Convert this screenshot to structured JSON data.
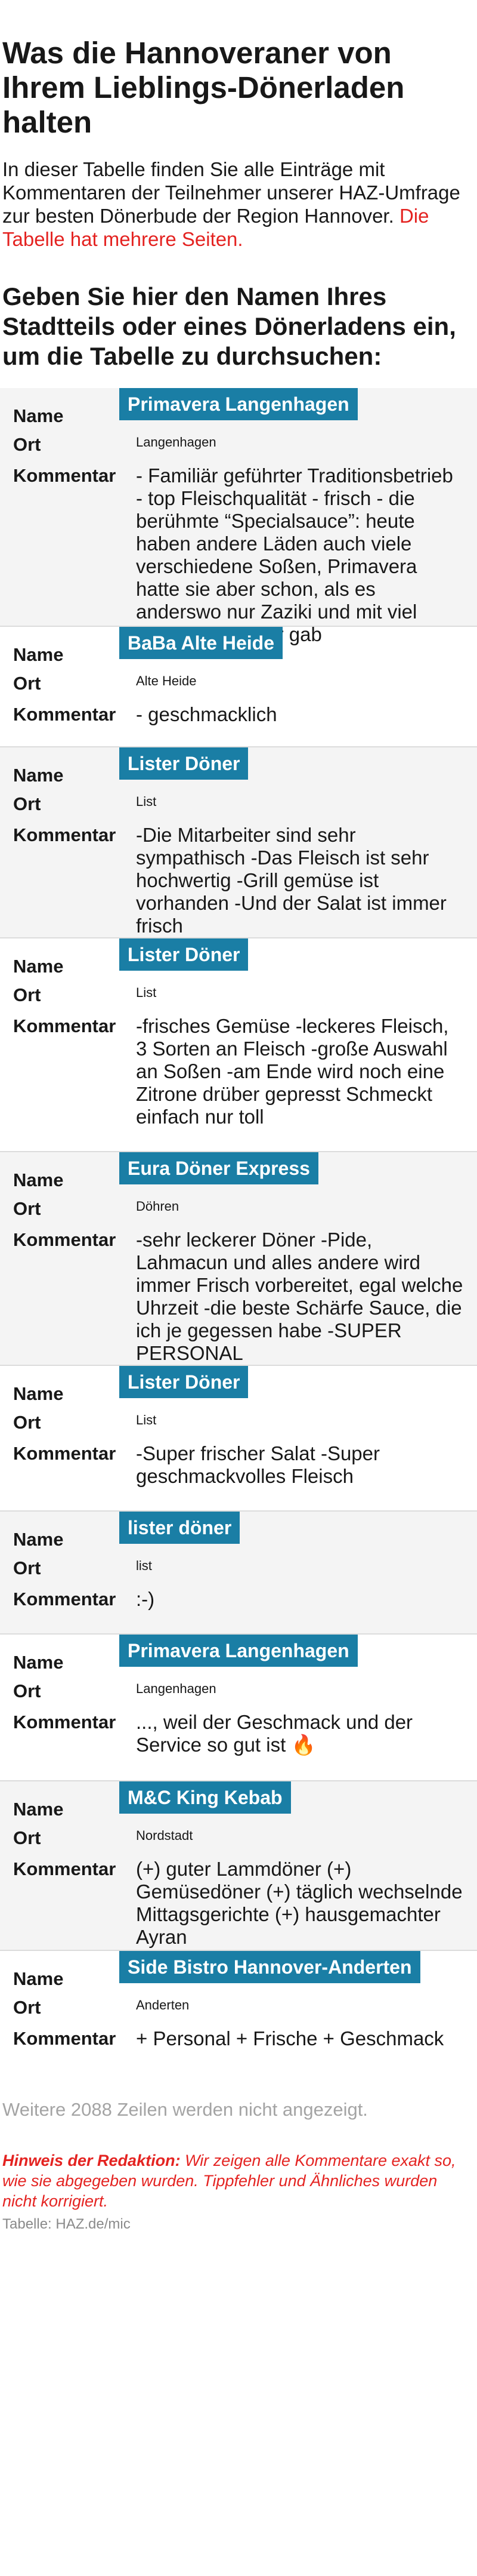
{
  "title": "Was die Hannoveraner von Ihrem Lieblings-Dönerladen halten",
  "intro": {
    "text": "In dieser Tabelle finden Sie alle Einträge mit Kommentaren der Teilnehmer unserer HAZ-Umfrage zur besten Dönerbude der Region Hannover.",
    "highlight": "Die Tabelle hat mehrere Seiten."
  },
  "search_heading": "Geben Sie hier den Namen Ihres Stadtteils oder eines Dönerladens ein, um die Tabelle zu durchsuchen:",
  "labels": {
    "name": "Name",
    "ort": "Ort",
    "kommentar": "Kommentar"
  },
  "rows": [
    {
      "name": "Primavera Langenhagen",
      "ort": "Langenhagen",
      "kommentar": "- Familiär geführter Traditionsbetrieb - top Fleischqualität - frisch - die berühmte “Specialsauce”: heute haben andere Läden auch viele verschiedene Soßen, Primavera hatte sie aber schon, als es anderswo nur Zaziki und mit viel Glück Chilipulver gab"
    },
    {
      "name": "BaBa Alte Heide",
      "ort": "Alte Heide",
      "kommentar": "- geschmacklich"
    },
    {
      "name": "Lister Döner",
      "ort": "List",
      "kommentar": "-Die Mitarbeiter sind sehr sympathisch -Das Fleisch ist sehr hochwertig -Grill gemüse ist vorhanden -Und der Salat ist immer frisch"
    },
    {
      "name": "Lister Döner",
      "ort": "List",
      "kommentar": "-frisches Gemüse -leckeres Fleisch, 3 Sorten an Fleisch -große Auswahl an Soßen -am Ende wird noch eine Zitrone drüber gepresst Schmeckt einfach nur toll"
    },
    {
      "name": "Eura Döner Express",
      "ort": "Döhren",
      "kommentar": "-sehr leckerer Döner -Pide, Lahmacun und alles andere wird immer Frisch vorbereitet, egal welche Uhrzeit -die beste Schärfe Sauce, die ich je gegessen habe -SUPER PERSONAL"
    },
    {
      "name": "Lister Döner",
      "ort": "List",
      "kommentar": "-Super frischer Salat -Super geschmackvolles Fleisch"
    },
    {
      "name": "lister döner",
      "ort": "list",
      "kommentar": ":-)"
    },
    {
      "name": "Primavera Langenhagen",
      "ort": "Langenhagen",
      "kommentar": "..., weil der Geschmack und der Service so gut ist 🔥"
    },
    {
      "name": "M&C King Kebab",
      "ort": "Nordstadt",
      "kommentar": "(+) guter Lammdöner (+) Gemüsedöner (+) täglich wechselnde Mittagsgerichte (+) hausgemachter Ayran"
    },
    {
      "name": "Side Bistro Hannover-Anderten",
      "ort": "Anderten",
      "kommentar": "+ Personal + Frische + Geschmack"
    }
  ],
  "more_rows": "Weitere 2088 Zeilen werden nicht angezeigt.",
  "hint": {
    "label": "Hinweis der Redaktion:",
    "text": " Wir zeigen alle Kommentare exakt so, wie sie abgegeben wurden. Tippfehler und Ähnliches wurden nicht korrigiert."
  },
  "source": "Tabelle: HAZ.de/mic",
  "colors": {
    "badge": "#1a7ea5",
    "highlight": "#e42321",
    "row_shade": "#f4f4f4"
  }
}
